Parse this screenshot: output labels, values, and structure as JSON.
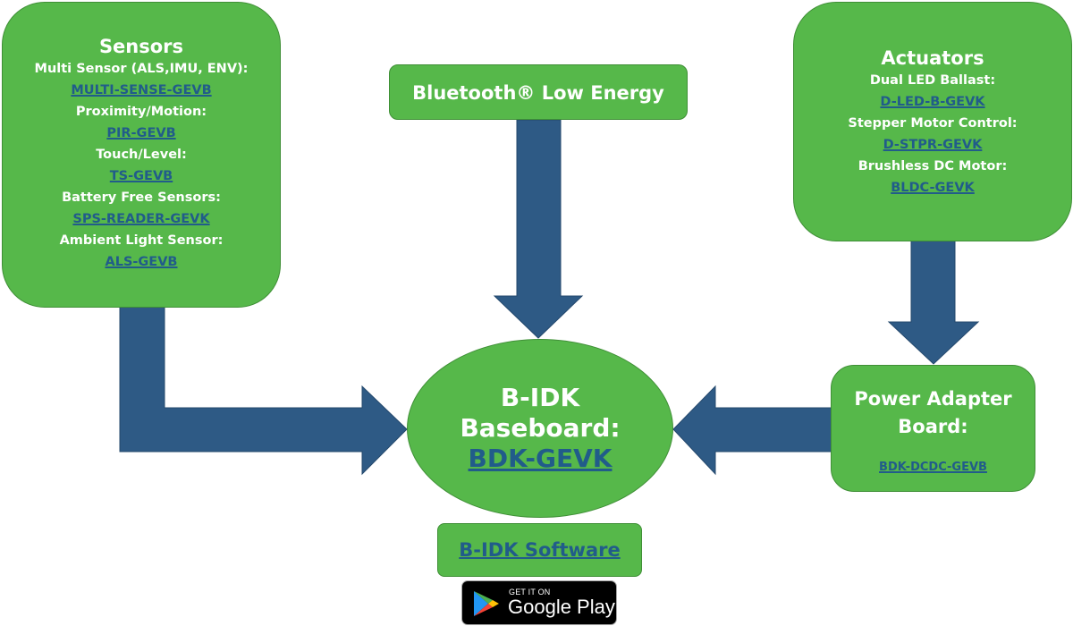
{
  "colors": {
    "box_fill": "#56b84a",
    "arrow_fill": "#2e5a85",
    "link": "#215c8a",
    "text": "#ffffff"
  },
  "sensors": {
    "title": "Sensors",
    "items": [
      {
        "label": "Multi Sensor (ALS,IMU, ENV):",
        "link": "MULTI-SENSE-GEVB"
      },
      {
        "label": "Proximity/Motion:",
        "link": "PIR-GEVB"
      },
      {
        "label": "Touch/Level:",
        "link": "TS-GEVB"
      },
      {
        "label": "Battery Free Sensors:",
        "link": "SPS-READER-GEVK"
      },
      {
        "label": "Ambient Light Sensor:",
        "link": "ALS-GEVB"
      }
    ]
  },
  "ble": {
    "title": "Bluetooth® Low Energy"
  },
  "actuators": {
    "title": "Actuators",
    "items": [
      {
        "label": "Dual LED Ballast:",
        "link": "D-LED-B-GEVK"
      },
      {
        "label": "Stepper Motor Control:",
        "link": "D-STPR-GEVK"
      },
      {
        "label": "Brushless DC Motor:",
        "link": "BLDC-GEVK"
      }
    ]
  },
  "baseboard": {
    "line1": "B-IDK",
    "line2": "Baseboard:",
    "link": "BDK-GEVK"
  },
  "power_adapter": {
    "line1": "Power Adapter",
    "line2": "Board:",
    "link": "BDK-DCDC-GEVB"
  },
  "software": {
    "link": "B-IDK Software"
  },
  "google_play": {
    "small": "GET IT ON",
    "big": "Google Play",
    "icon": "google-play-icon"
  },
  "arrows": [
    {
      "from": "sensors",
      "to": "baseboard"
    },
    {
      "from": "ble",
      "to": "baseboard"
    },
    {
      "from": "actuators",
      "to": "power_adapter"
    },
    {
      "from": "power_adapter",
      "to": "baseboard"
    }
  ]
}
